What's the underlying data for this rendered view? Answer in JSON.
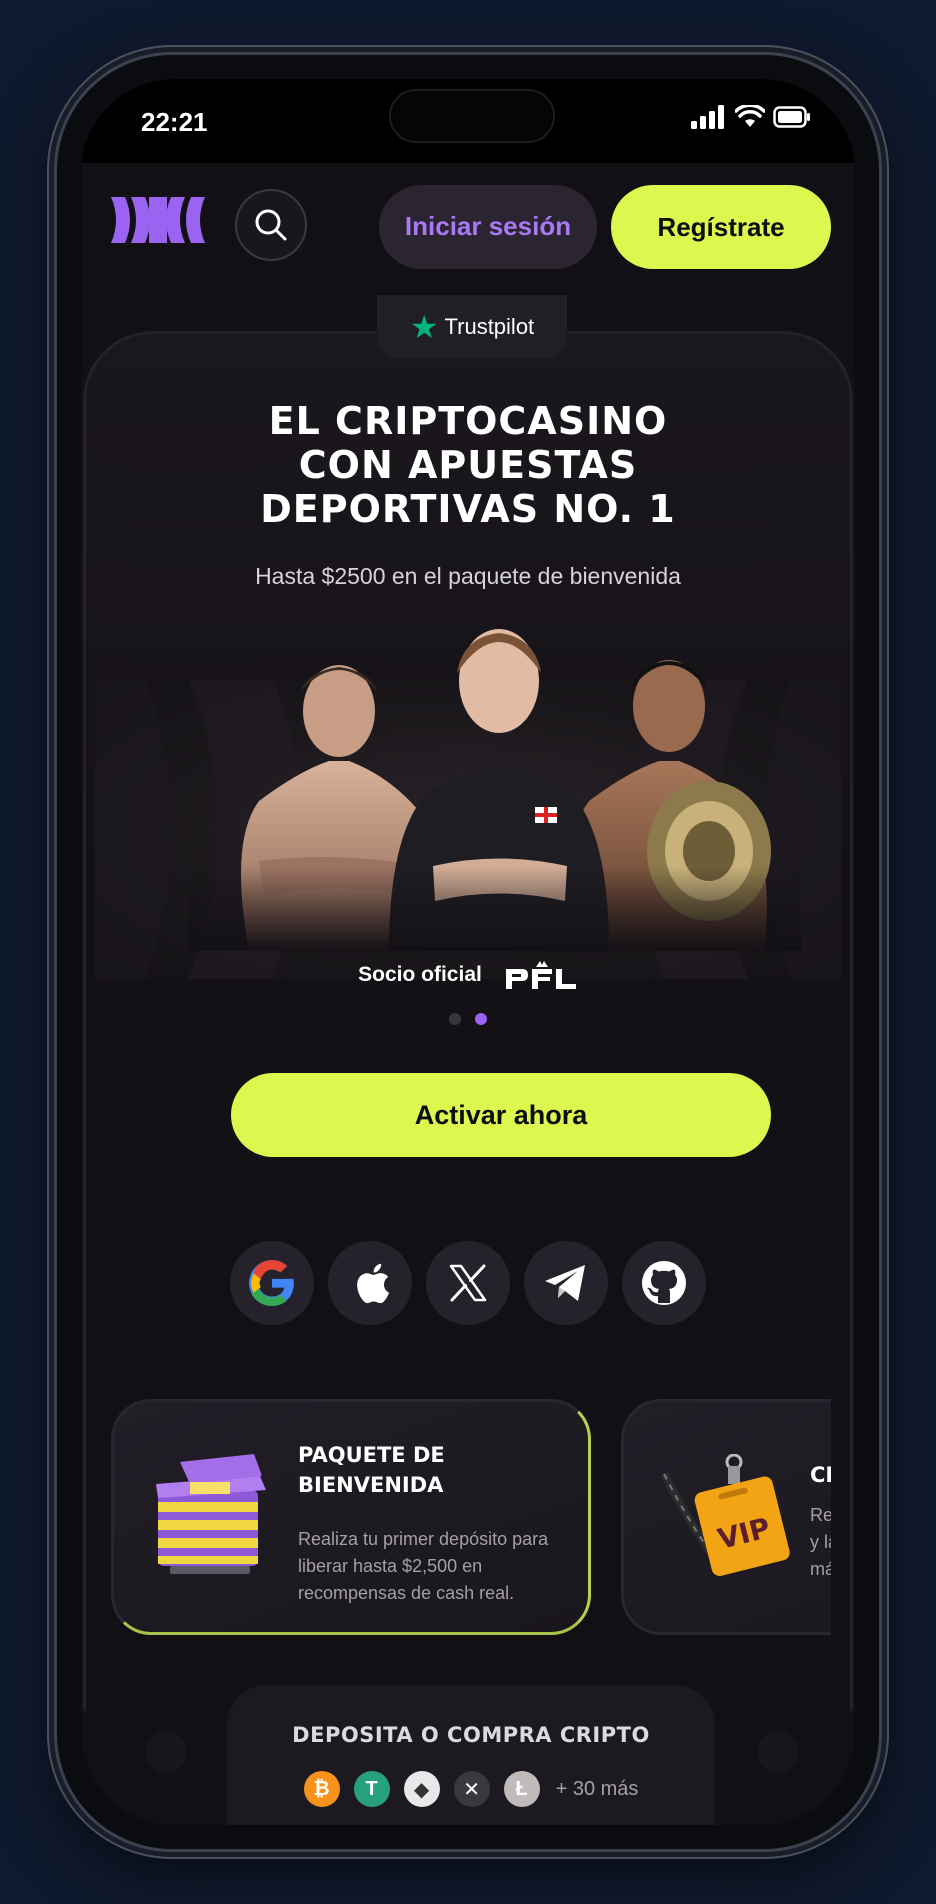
{
  "status_bar": {
    "time": "22:21"
  },
  "header": {
    "login_label": "Iniciar sesión",
    "register_label": "Regístrate"
  },
  "hero": {
    "trustpilot_label": "Trustpilot",
    "title_lines": [
      "EL CRIPTOCASINO",
      "CON APUESTAS",
      "DEPORTIVAS NO. 1"
    ],
    "subtitle": "Hasta $2500 en el paquete de bienvenida",
    "partner_label": "Socio oficial",
    "partner_logo": "PFL",
    "slide_count": 2,
    "active_slide": 2,
    "cta_label": "Activar ahora"
  },
  "social_logins": [
    {
      "name": "google-icon"
    },
    {
      "name": "apple-icon"
    },
    {
      "name": "x-icon"
    },
    {
      "name": "telegram-icon"
    },
    {
      "name": "github-icon"
    }
  ],
  "promo_cards": [
    {
      "title": "PAQUETE DE BIENVENIDA",
      "description": "Realiza tu primer depósito para liberar hasta $2,500 en recompensas de cash real."
    },
    {
      "title": "CI",
      "description_lines": [
        "Re",
        "y la",
        "má"
      ],
      "badge": "VIP"
    }
  ],
  "deposit": {
    "title": "DEPOSITA O COMPRA CRIPTO",
    "coins": [
      {
        "name": "bitcoin-icon",
        "color": "#f7931a",
        "glyph": "₿"
      },
      {
        "name": "tether-icon",
        "color": "#26a17b",
        "glyph": "T"
      },
      {
        "name": "ethereum-icon",
        "color": "#e8e8e8",
        "glyph": "◆"
      },
      {
        "name": "xrp-icon",
        "color": "#3a3840",
        "glyph": "✕"
      },
      {
        "name": "litecoin-icon",
        "color": "#bfbbbb",
        "glyph": "Ł"
      }
    ],
    "more_label": "+ 30 más"
  },
  "colors": {
    "accent_lime": "#dcf84f",
    "accent_purple": "#9a63f1",
    "background": "#131015"
  }
}
